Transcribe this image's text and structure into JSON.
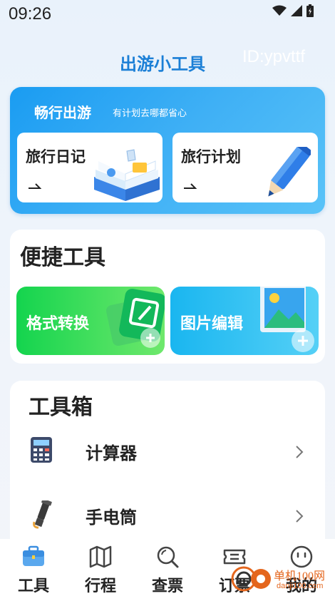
{
  "status_bar": {
    "time": "09:26"
  },
  "header": {
    "title": "出游小工具",
    "user_id": "ID:ypvttf"
  },
  "travel": {
    "title": "畅行出游",
    "subtitle": "有计划去哪都省心",
    "cards": [
      {
        "label": "旅行日记",
        "icon": "open-book-icon"
      },
      {
        "label": "旅行计划",
        "icon": "pencil-icon"
      }
    ]
  },
  "quick_tools": {
    "title": "便捷工具",
    "tiles": [
      {
        "label": "格式转换",
        "icon": "format-convert-icon"
      },
      {
        "label": "图片编辑",
        "icon": "image-edit-icon"
      }
    ]
  },
  "toolbox": {
    "title": "工具箱",
    "items": [
      {
        "label": "计算器",
        "icon": "calculator-icon"
      },
      {
        "label": "手电筒",
        "icon": "flashlight-icon"
      }
    ]
  },
  "nav": {
    "items": [
      {
        "label": "工具",
        "icon": "toolbox-icon",
        "active": true
      },
      {
        "label": "行程",
        "icon": "map-icon"
      },
      {
        "label": "查票",
        "icon": "search-icon"
      },
      {
        "label": "订票",
        "icon": "ticket-icon"
      },
      {
        "label": "我的",
        "icon": "profile-icon"
      }
    ]
  },
  "watermark": {
    "text": "单机100网",
    "url": "danji100.com"
  },
  "colors": {
    "accent": "#1b7fd6",
    "travel_gradient_start": "#1a9cf2",
    "green_tile": "#14d44e",
    "blue_tile": "#1ab6f0"
  }
}
